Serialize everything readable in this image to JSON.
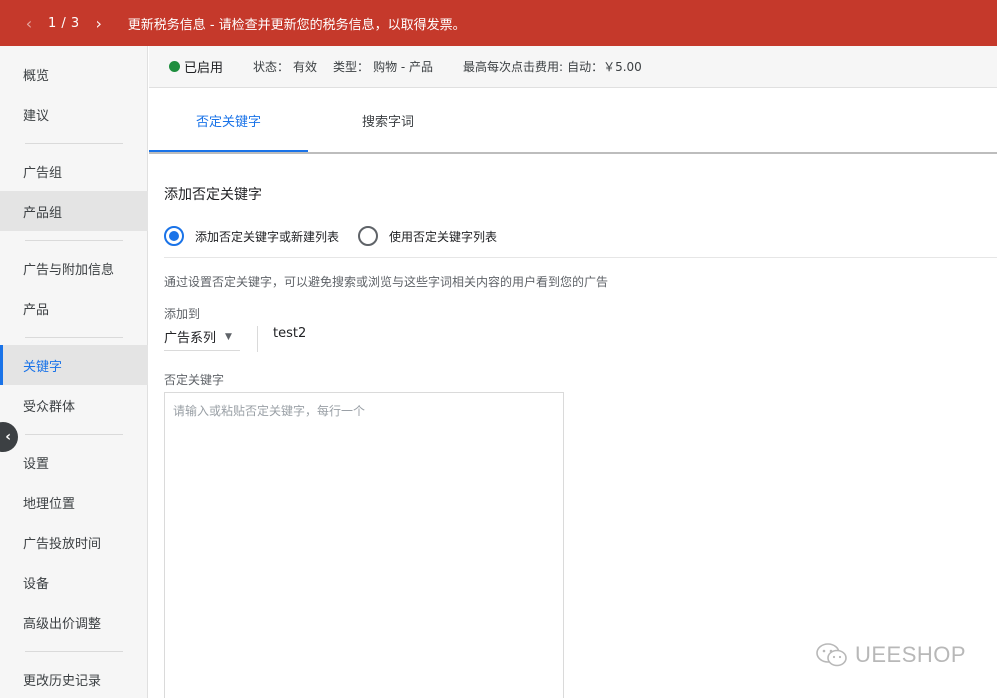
{
  "alert": {
    "counter": "1 / 3",
    "message": "更新税务信息 - 请检查并更新您的税务信息，以取得发票。",
    "prev_icon": "chevron-left-icon",
    "next_icon": "chevron-right-icon"
  },
  "sidebar": {
    "items": [
      {
        "label": "概览"
      },
      {
        "label": "建议"
      },
      {
        "label": "广告组"
      },
      {
        "label": "产品组"
      },
      {
        "label": "广告与附加信息"
      },
      {
        "label": "产品"
      },
      {
        "label": "关键字"
      },
      {
        "label": "受众群体"
      },
      {
        "label": "设置"
      },
      {
        "label": "地理位置"
      },
      {
        "label": "广告投放时间"
      },
      {
        "label": "设备"
      },
      {
        "label": "高级出价调整"
      },
      {
        "label": "更改历史记录"
      }
    ],
    "active": "关键字",
    "collapse_icon": "chevron-left-icon"
  },
  "status": {
    "enabled": "已启用",
    "state_label": "状态：",
    "state_value": "有效",
    "type_label": "类型：",
    "type_value": "购物 - 产品",
    "max_cpc_label": "最高每次点击费用:",
    "max_cpc_value": "自动：￥5.00",
    "status_color": "#1e8e3e"
  },
  "tabs": [
    {
      "label": "否定关键字",
      "selected": true
    },
    {
      "label": "搜索字词",
      "selected": false
    }
  ],
  "main": {
    "title": "添加否定关键字",
    "radio_options": [
      {
        "label": "添加否定关键字或新建列表",
        "checked": true
      },
      {
        "label": "使用否定关键字列表",
        "checked": false
      }
    ],
    "description": "通过设置否定关键字，可以避免搜索或浏览与这些字词相关内容的用户看到您的广告",
    "add_to_label": "添加到",
    "level_select": "广告系列",
    "campaign_name": "test2",
    "keywords_label": "否定关键字",
    "keywords_placeholder": "请输入或粘贴否定关键字，每行一个"
  },
  "watermark": {
    "text": "UEESHOP",
    "icon": "wechat-icon"
  },
  "colors": {
    "alert_bg": "#c5392b",
    "accent": "#1a73e8"
  }
}
